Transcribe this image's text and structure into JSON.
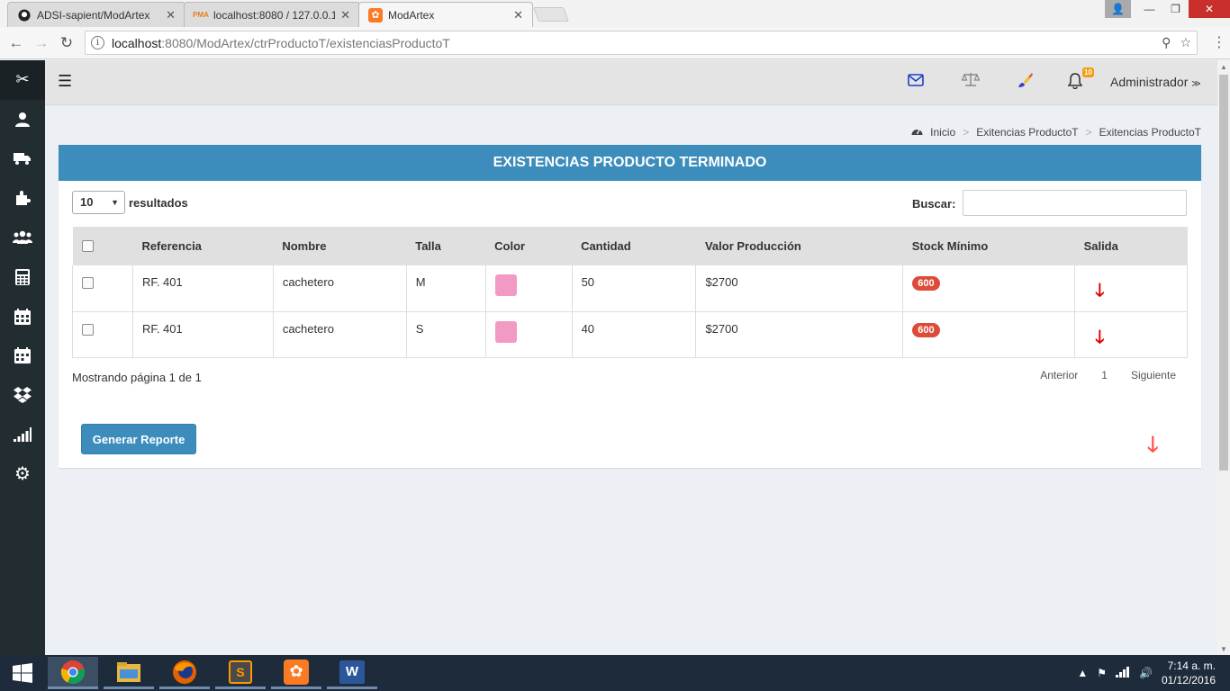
{
  "browser": {
    "tabs": [
      {
        "title": "ADSI-sapient/ModArtex",
        "icon": "github-icon"
      },
      {
        "title": "localhost:8080 / 127.0.0.1",
        "icon": "phpmyadmin-icon"
      },
      {
        "title": "ModArtex",
        "icon": "xampp-icon"
      }
    ],
    "url_host": "localhost",
    "url_path": ":8080/ModArtex/ctrProductoT/existenciasProductoT"
  },
  "sidebar": {
    "items": [
      "scissors-icon",
      "user-icon",
      "truck-icon",
      "puzzle-icon",
      "users-icon",
      "calculator-icon",
      "calendar-icon",
      "calendar-check-icon",
      "dropbox-icon",
      "signal-icon",
      "cogs-icon"
    ]
  },
  "topnav": {
    "notification_count": "10",
    "user": "Administrador"
  },
  "breadcrumb": [
    "Inicio",
    "Exitencias ProductoT",
    "Exitencias ProductoT"
  ],
  "panel": {
    "title": "EXISTENCIAS PRODUCTO TERMINADO",
    "length_value": "10",
    "length_label": "resultados",
    "search_label": "Buscar:",
    "search_value": ""
  },
  "table": {
    "headers": [
      "Referencia",
      "Nombre",
      "Talla",
      "Color",
      "Cantidad",
      "Valor Producción",
      "Stock Mínimo",
      "Salida"
    ],
    "rows": [
      {
        "referencia": "RF. 401",
        "nombre": "cachetero",
        "talla": "M",
        "color": "#f29ac3",
        "cantidad": "50",
        "valor": "$2700",
        "stock": "600"
      },
      {
        "referencia": "RF. 401",
        "nombre": "cachetero",
        "talla": "S",
        "color": "#f29ac3",
        "cantidad": "40",
        "valor": "$2700",
        "stock": "600"
      }
    ]
  },
  "pagination": {
    "info": "Mostrando página 1 de 1",
    "prev": "Anterior",
    "page": "1",
    "next": "Siguiente"
  },
  "report_button": "Generar Reporte",
  "taskbar": {
    "apps": [
      "chrome-icon",
      "file-explorer-icon",
      "firefox-icon",
      "sublime-text-icon",
      "xampp-icon",
      "word-icon"
    ],
    "time": "7:14 a. m.",
    "date": "01/12/2016"
  }
}
